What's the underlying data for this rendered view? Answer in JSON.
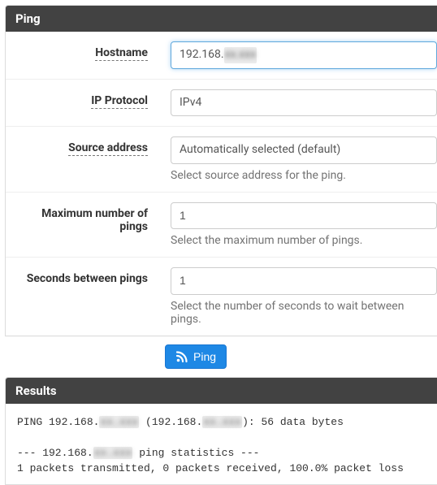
{
  "panel": {
    "title": "Ping"
  },
  "form": {
    "hostname": {
      "label": "Hostname",
      "value": "192.168.",
      "obscured": "xx.xxx"
    },
    "ip_protocol": {
      "label": "IP Protocol",
      "value": "IPv4"
    },
    "source_address": {
      "label": "Source address",
      "value": "Automatically selected (default)",
      "help": "Select source address for the ping."
    },
    "max_pings": {
      "label": "Maximum number of pings",
      "value": "1",
      "help": "Select the maximum number of pings."
    },
    "seconds_between": {
      "label": "Seconds between pings",
      "value": "1",
      "help": "Select the number of seconds to wait between pings."
    }
  },
  "button": {
    "ping_label": "Ping"
  },
  "results": {
    "title": "Results",
    "line1_a": "PING 192.168.",
    "line1_b": " (192.168.",
    "line1_c": "): 56 data bytes",
    "line2_a": "--- 192.168.",
    "line2_b": " ping statistics ---",
    "line3": "1 packets transmitted, 0 packets received, 100.0% packet loss",
    "obscured": "xx.xxx"
  }
}
